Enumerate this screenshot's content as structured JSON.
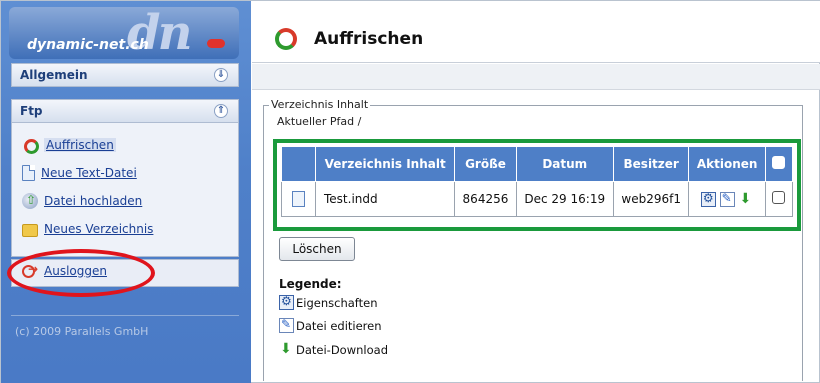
{
  "logo": {
    "text": "dynamic-net.ch",
    "mark": "dn"
  },
  "sidebar": {
    "panels": [
      {
        "title": "Allgemein",
        "state": "collapsed"
      },
      {
        "title": "Ftp",
        "state": "expanded"
      }
    ],
    "ftp_items": [
      {
        "label": "Auffrischen",
        "icon": "refresh-icon"
      },
      {
        "label": "Neue Text-Datei",
        "icon": "new-text-file-icon"
      },
      {
        "label": "Datei hochladen",
        "icon": "upload-icon"
      },
      {
        "label": "Neues Verzeichnis",
        "icon": "new-folder-icon"
      }
    ],
    "logout_label": "Ausloggen",
    "copyright": "(c) 2009 Parallels GmbH"
  },
  "main": {
    "title": "Auffrischen",
    "fieldset_legend": "Verzeichnis Inhalt",
    "current_path": "Aktueller Pfad /",
    "table": {
      "headers": [
        "Verzeichnis Inhalt",
        "Größe",
        "Datum",
        "Besitzer",
        "Aktionen"
      ],
      "rows": [
        {
          "name": "Test.indd",
          "size": "864256",
          "date": "Dec 29 16:19",
          "owner": "web296f1"
        }
      ]
    },
    "delete_label": "Löschen",
    "legend": {
      "title": "Legende:",
      "items": [
        "Eigenschaften",
        "Datei editieren",
        "Datei-Download"
      ]
    }
  },
  "colors": {
    "sidebar_blue": "#4f80c9",
    "table_header": "#4e7fc7",
    "highlight_green": "#1a9a3c",
    "highlight_red": "#e0141c"
  }
}
